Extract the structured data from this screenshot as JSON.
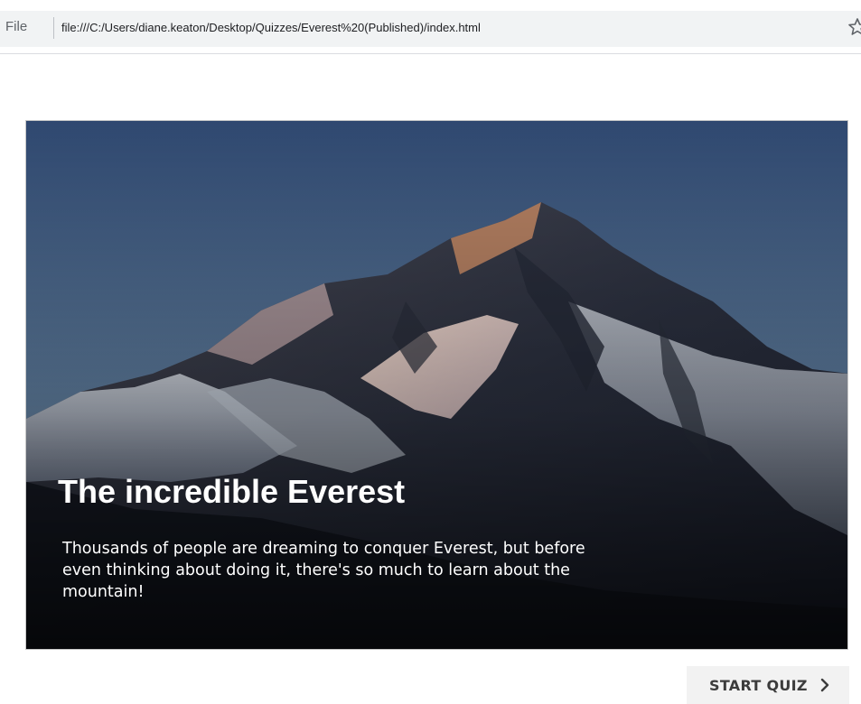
{
  "browser": {
    "scheme_label": "File",
    "url": "file:///C:/Users/diane.keaton/Desktop/Quizzes/Everest%20(Published)/index.html",
    "bookmark_icon": "star-icon"
  },
  "hero": {
    "image": "mountain-everest-photo",
    "title": "The incredible Everest",
    "description": "Thousands of people are dreaming to conquer Everest, but before even thinking about doing it, there's so much to learn about the mountain!"
  },
  "actions": {
    "start_label": "START QUIZ",
    "start_icon": "chevron-right-icon"
  }
}
